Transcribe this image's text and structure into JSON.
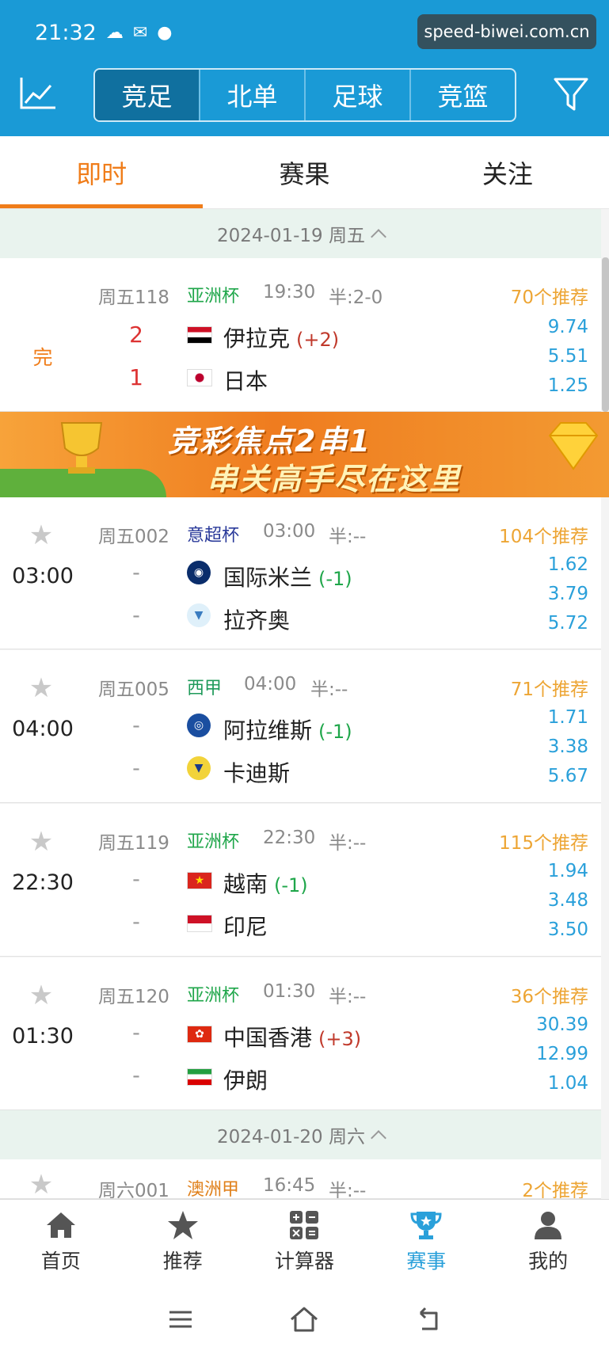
{
  "status_bar": {
    "time": "21:32"
  },
  "watermark": "speed-biwei.com.cn",
  "header": {
    "segments": [
      "竞足",
      "北单",
      "足球",
      "竞篮"
    ],
    "active_segment": 0
  },
  "tabs": [
    "即时",
    "赛果",
    "关注"
  ],
  "date_headers": [
    "2024-01-19 周五",
    "2024-01-20 周六"
  ],
  "banner": {
    "line1": "竞彩焦点2串1",
    "line2": "串关高手尽在这里"
  },
  "matches": [
    {
      "status": "完",
      "code": "周五118",
      "league": "亚洲杯",
      "league_color": "#1fa64a",
      "kickoff": "19:30",
      "half": "半:2-0",
      "recs": "70个推荐",
      "home": {
        "name": "伊拉克",
        "score": "2",
        "handicap": "(+2)"
      },
      "away": {
        "name": "日本",
        "score": "1"
      },
      "odds": [
        "9.74",
        "5.51",
        "1.25"
      ]
    },
    {
      "time": "03:00",
      "code": "周五002",
      "league": "意超杯",
      "league_color": "#2a3a9a",
      "kickoff": "03:00",
      "half": "半:--",
      "recs": "104个推荐",
      "home": {
        "name": "国际米兰",
        "score": "-",
        "handicap": "(-1)"
      },
      "away": {
        "name": "拉齐奥",
        "score": "-"
      },
      "odds": [
        "1.62",
        "3.79",
        "5.72"
      ]
    },
    {
      "time": "04:00",
      "code": "周五005",
      "league": "西甲",
      "league_color": "#1f9a5a",
      "kickoff": "04:00",
      "half": "半:--",
      "recs": "71个推荐",
      "home": {
        "name": "阿拉维斯",
        "score": "-",
        "handicap": "(-1)"
      },
      "away": {
        "name": "卡迪斯",
        "score": "-"
      },
      "odds": [
        "1.71",
        "3.38",
        "5.67"
      ]
    },
    {
      "time": "22:30",
      "code": "周五119",
      "league": "亚洲杯",
      "league_color": "#1fa64a",
      "kickoff": "22:30",
      "half": "半:--",
      "recs": "115个推荐",
      "home": {
        "name": "越南",
        "score": "-",
        "handicap": "(-1)"
      },
      "away": {
        "name": "印尼",
        "score": "-"
      },
      "odds": [
        "1.94",
        "3.48",
        "3.50"
      ]
    },
    {
      "time": "01:30",
      "code": "周五120",
      "league": "亚洲杯",
      "league_color": "#1fa64a",
      "kickoff": "01:30",
      "half": "半:--",
      "recs": "36个推荐",
      "home": {
        "name": "中国香港",
        "score": "-",
        "handicap": "(+3)"
      },
      "away": {
        "name": "伊朗",
        "score": "-"
      },
      "odds": [
        "30.39",
        "12.99",
        "1.04"
      ]
    },
    {
      "code": "周六001",
      "league": "澳洲甲",
      "league_color": "#e0801a",
      "kickoff": "16:45",
      "half": "半:--",
      "recs": "2个推荐"
    }
  ],
  "bottom_nav": [
    "首页",
    "推荐",
    "计算器",
    "赛事",
    "我的"
  ],
  "colors": {
    "primary": "#1a9ad6",
    "accent": "#f07d1a",
    "odds": "#2aa0da",
    "recs": "#eda534"
  }
}
